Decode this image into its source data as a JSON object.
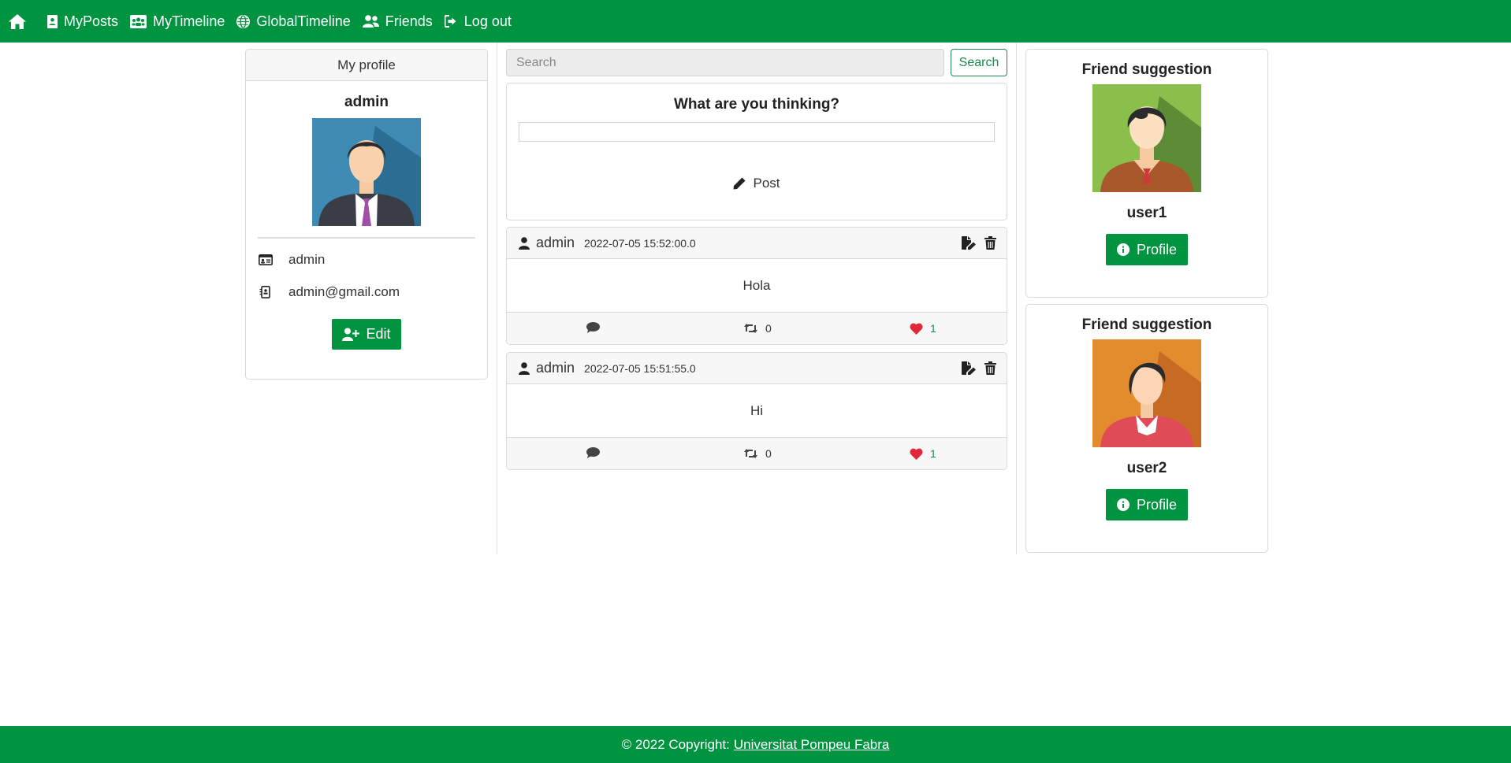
{
  "navbar": {
    "home_icon": "home-icon",
    "items": [
      {
        "label": "MyPosts",
        "icon": "user-card-icon"
      },
      {
        "label": "MyTimeline",
        "icon": "users-group-icon"
      },
      {
        "label": "GlobalTimeline",
        "icon": "globe-icon"
      },
      {
        "label": "Friends",
        "icon": "user-friends-icon"
      },
      {
        "label": "Log out",
        "icon": "sign-out-icon"
      }
    ]
  },
  "profile": {
    "header": "My profile",
    "name": "admin",
    "username": "admin",
    "email": "admin@gmail.com",
    "edit_label": "Edit"
  },
  "search": {
    "placeholder": "Search",
    "button_label": "Search"
  },
  "compose": {
    "title": "What are you thinking?",
    "post_label": "Post"
  },
  "posts": [
    {
      "author": "admin",
      "time": "2022-07-05 15:52:00.0",
      "content": "Hola",
      "retweets": "0",
      "likes": "1"
    },
    {
      "author": "admin",
      "time": "2022-07-05 15:51:55.0",
      "content": "Hi",
      "retweets": "0",
      "likes": "1"
    }
  ],
  "suggestions": [
    {
      "title": "Friend suggestion",
      "name": "user1",
      "button_label": "Profile"
    },
    {
      "title": "Friend suggestion",
      "name": "user2",
      "button_label": "Profile"
    }
  ],
  "footer": {
    "text": "© 2022 Copyright:",
    "link": "Universitat Pompeu Fabra"
  },
  "colors": {
    "brand_green": "#009440",
    "heart_red": "#e0283a",
    "retweet_green": "#1b8a4a"
  }
}
